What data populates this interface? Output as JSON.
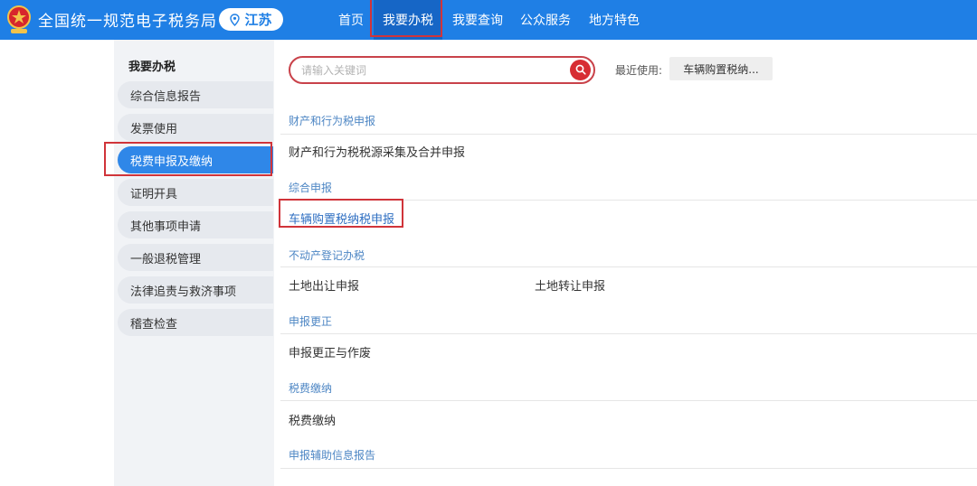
{
  "header": {
    "site_title": "全国统一规范电子税务局",
    "region": "江苏",
    "nav": [
      "首页",
      "我要办税",
      "我要查询",
      "公众服务",
      "地方特色"
    ],
    "active_nav": "我要办税"
  },
  "sidebar": {
    "title": "我要办税",
    "items": [
      "综合信息报告",
      "发票使用",
      "税费申报及缴纳",
      "证明开具",
      "其他事项申请",
      "一般退税管理",
      "法律追责与救济事项",
      "稽查检查"
    ],
    "active_item": "税费申报及缴纳"
  },
  "search": {
    "placeholder": "请输入关键词",
    "recent_label": "最近使用:",
    "recent_item": "车辆购置税纳..."
  },
  "sections": [
    {
      "title": "财产和行为税申报",
      "links": [
        "财产和行为税税源采集及合并申报"
      ]
    },
    {
      "title": "综合申报",
      "links": [
        "车辆购置税纳税申报"
      ]
    },
    {
      "title": "不动产登记办税",
      "links": [
        "土地出让申报",
        "土地转让申报"
      ]
    },
    {
      "title": "申报更正",
      "links": [
        "申报更正与作废"
      ]
    },
    {
      "title": "税费缴纳",
      "links": [
        "税费缴纳"
      ]
    },
    {
      "title": "申报辅助信息报告",
      "links": []
    }
  ],
  "colors": {
    "header_bg": "#1f7fe5",
    "active_menu": "#2f87e8",
    "highlight_border": "#d0343a",
    "section_title": "#4d86c4"
  }
}
